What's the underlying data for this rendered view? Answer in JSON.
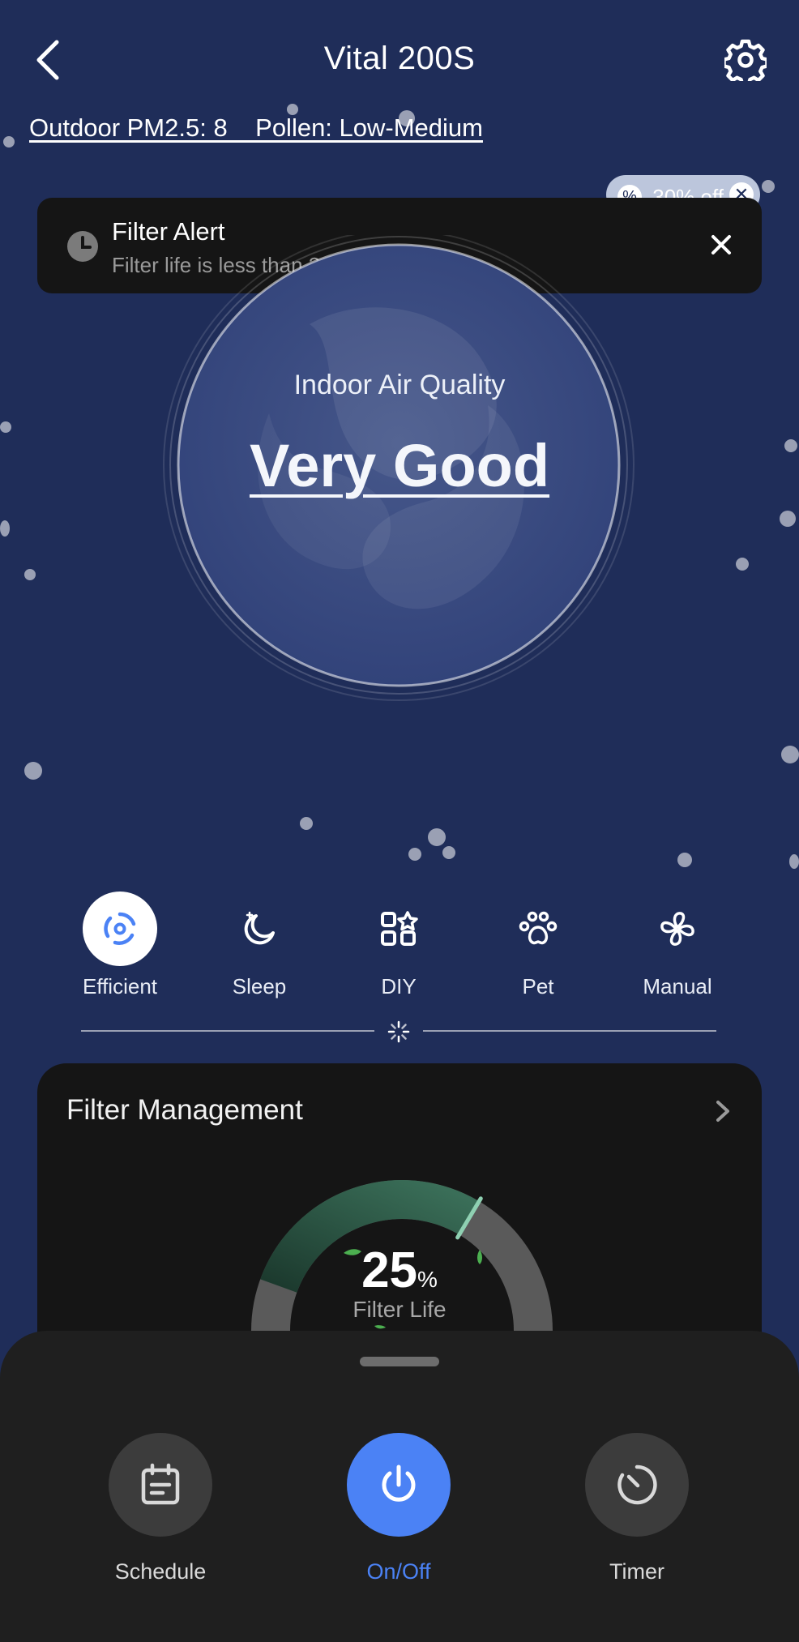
{
  "header": {
    "title": "Vital 200S",
    "back_icon": "chevron-left-icon",
    "settings_icon": "gear-icon"
  },
  "outdoor": {
    "text": "Outdoor PM2.5: 8    Pollen: Low-Medium"
  },
  "promo": {
    "label": "30% off",
    "icon": "discount-badge-icon",
    "close_icon": "close-icon"
  },
  "alert": {
    "title": "Filter Alert",
    "message": "Filter life is less than 30%",
    "icon": "clock-icon",
    "close_icon": "close-icon"
  },
  "air_quality": {
    "label": "Indoor Air Quality",
    "value": "Very Good"
  },
  "modes": {
    "items": [
      {
        "label": "Efficient",
        "icon": "efficient-icon",
        "active": true
      },
      {
        "label": "Sleep",
        "icon": "moon-icon",
        "active": false
      },
      {
        "label": "DIY",
        "icon": "diy-grid-icon",
        "active": false
      },
      {
        "label": "Pet",
        "icon": "paw-icon",
        "active": false
      },
      {
        "label": "Manual",
        "icon": "fan-icon",
        "active": false
      }
    ]
  },
  "filter_management": {
    "title": "Filter Management",
    "value": "25",
    "unit": "%",
    "label": "Filter Life",
    "percent": 25
  },
  "controls": {
    "schedule": "Schedule",
    "onoff": "On/Off",
    "timer": "Timer"
  },
  "colors": {
    "background": "#1f2d59",
    "accent": "#4b82f5",
    "card": "#151515",
    "sheet": "#1f1f1f"
  }
}
